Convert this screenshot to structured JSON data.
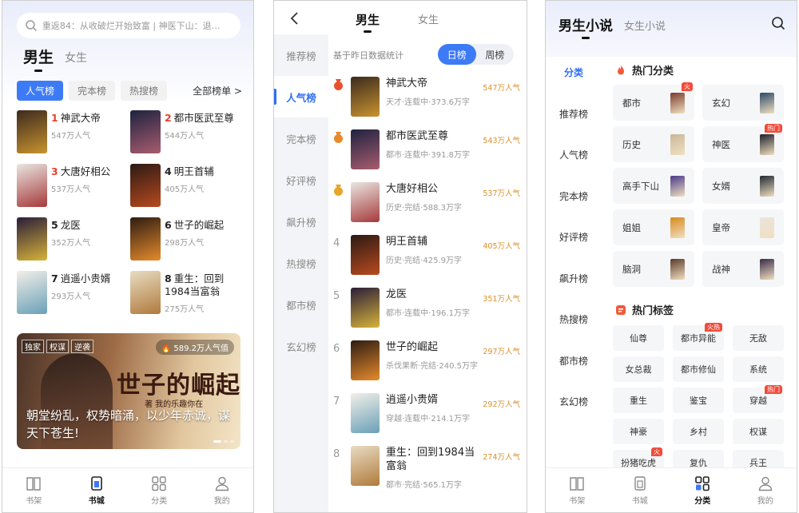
{
  "colors": {
    "accent": "#3d7af6",
    "rank_red": "#e8412c",
    "popularity": "#d8902a",
    "badge": "#f24b3a"
  },
  "p1": {
    "search_placeholder": "重返84：从收破烂开始致富 | 神医下山：退…",
    "gender_tabs": [
      "男生",
      "女生"
    ],
    "rank_tabs": [
      "人气榜",
      "完本榜",
      "热搜榜"
    ],
    "all_ranks": "全部榜单 >",
    "books": [
      {
        "rank": "1",
        "title": "神武大帝",
        "pop": "547万人气",
        "color1": "#3b2a1e",
        "color2": "#c9932f"
      },
      {
        "rank": "2",
        "title": "都市医武至尊",
        "pop": "544万人气",
        "color1": "#1e2340",
        "color2": "#a85c6e"
      },
      {
        "rank": "3",
        "title": "大唐好相公",
        "pop": "537万人气",
        "color1": "#e9e6e2",
        "color2": "#a53a3a"
      },
      {
        "rank": "4",
        "title": "明王首辅",
        "pop": "405万人气",
        "color1": "#2b1a14",
        "color2": "#b84a1e"
      },
      {
        "rank": "5",
        "title": "龙医",
        "pop": "352万人气",
        "color1": "#2a1d3a",
        "color2": "#d7b33a"
      },
      {
        "rank": "6",
        "title": "世子的崛起",
        "pop": "298万人气",
        "color1": "#2e1c12",
        "color2": "#e58b2c"
      },
      {
        "rank": "7",
        "title": "逍遥小贵婿",
        "pop": "293万人气",
        "color1": "#f2efe8",
        "color2": "#6aa0b8"
      },
      {
        "rank": "8",
        "title": "重生：回到1984当富翁",
        "pop": "275万人气",
        "color1": "#e8dcc3",
        "color2": "#b07a3c"
      }
    ],
    "banner": {
      "tags": [
        "独家",
        "权谋",
        "逆袭"
      ],
      "hot": "589.2万人气值",
      "title": "世子的崛起",
      "subtitle": "著 我的乐趣你在",
      "desc": "朝堂纷乱，权势暗涌，以少年赤诚，谋天下苍生!"
    },
    "tabbar": [
      "书架",
      "书城",
      "分类",
      "我的"
    ]
  },
  "p2": {
    "gender_tabs": [
      "男生",
      "女生"
    ],
    "side": [
      "推荐榜",
      "人气榜",
      "完本榜",
      "好评榜",
      "飙升榜",
      "热搜榜",
      "都市榜",
      "玄幻榜"
    ],
    "stat_label": "基于昨日数据统计",
    "seg": [
      "日榜",
      "周榜"
    ],
    "rows": [
      {
        "rank": "1",
        "title": "神武大帝",
        "meta": "天才·连载中·373.6万字",
        "pop": "547万人气",
        "color1": "#3b2a1e",
        "color2": "#c9932f"
      },
      {
        "rank": "2",
        "title": "都市医武至尊",
        "meta": "都市·连载中·391.8万字",
        "pop": "543万人气",
        "color1": "#1e2340",
        "color2": "#a85c6e"
      },
      {
        "rank": "3",
        "title": "大唐好相公",
        "meta": "历史·完结·588.3万字",
        "pop": "537万人气",
        "color1": "#e9e6e2",
        "color2": "#a53a3a"
      },
      {
        "rank": "4",
        "title": "明王首辅",
        "meta": "历史·完结·425.9万字",
        "pop": "405万人气",
        "color1": "#2b1a14",
        "color2": "#b84a1e"
      },
      {
        "rank": "5",
        "title": "龙医",
        "meta": "都市·连载中·196.1万字",
        "pop": "351万人气",
        "color1": "#2a1d3a",
        "color2": "#d7b33a"
      },
      {
        "rank": "6",
        "title": "世子的崛起",
        "meta": "杀伐果断·完结·240.5万字",
        "pop": "297万人气",
        "color1": "#2e1c12",
        "color2": "#e58b2c"
      },
      {
        "rank": "7",
        "title": "逍遥小贵婿",
        "meta": "穿越·连载中·214.1万字",
        "pop": "292万人气",
        "color1": "#f2efe8",
        "color2": "#6aa0b8"
      },
      {
        "rank": "8",
        "title": "重生：回到1984当富翁",
        "meta": "都市·完结·565.1万字",
        "pop": "274万人气",
        "color1": "#e8dcc3",
        "color2": "#b07a3c"
      }
    ]
  },
  "p3": {
    "gender_tabs": [
      "男生小说",
      "女生小说"
    ],
    "side": [
      "分类",
      "推荐榜",
      "人气榜",
      "完本榜",
      "好评榜",
      "飙升榜",
      "热搜榜",
      "都市榜",
      "玄幻榜"
    ],
    "hot_categories_title": "热门分类",
    "categories": [
      {
        "label": "都市",
        "badge": "火",
        "color": "#7a3b2e"
      },
      {
        "label": "玄幻",
        "badge": "",
        "color": "#2b4a6a"
      },
      {
        "label": "历史",
        "badge": "",
        "color": "#c9b79a"
      },
      {
        "label": "神医",
        "badge": "热门",
        "color": "#1f1f2a"
      },
      {
        "label": "高手下山",
        "badge": "",
        "color": "#4a3a8a"
      },
      {
        "label": "女婿",
        "badge": "",
        "color": "#222831"
      },
      {
        "label": "姐姐",
        "badge": "",
        "color": "#d88a1e"
      },
      {
        "label": "皇帝",
        "badge": "",
        "color": "#e9e4da"
      },
      {
        "label": "脑洞",
        "badge": "",
        "color": "#5a3a2a"
      },
      {
        "label": "战神",
        "badge": "",
        "color": "#3a2a4a"
      }
    ],
    "hot_tags_title": "热门标签",
    "tags": [
      {
        "label": "仙尊",
        "badge": ""
      },
      {
        "label": "都市异能",
        "badge": "火热"
      },
      {
        "label": "无敌",
        "badge": ""
      },
      {
        "label": "女总裁",
        "badge": ""
      },
      {
        "label": "都市修仙",
        "badge": ""
      },
      {
        "label": "系统",
        "badge": ""
      },
      {
        "label": "重生",
        "badge": ""
      },
      {
        "label": "鉴宝",
        "badge": ""
      },
      {
        "label": "穿越",
        "badge": "热门"
      },
      {
        "label": "神豪",
        "badge": ""
      },
      {
        "label": "乡村",
        "badge": ""
      },
      {
        "label": "权谋",
        "badge": ""
      },
      {
        "label": "扮猪吃虎",
        "badge": "火"
      },
      {
        "label": "复仇",
        "badge": ""
      },
      {
        "label": "兵王",
        "badge": ""
      }
    ],
    "tabbar": [
      "书架",
      "书城",
      "分类",
      "我的"
    ]
  }
}
